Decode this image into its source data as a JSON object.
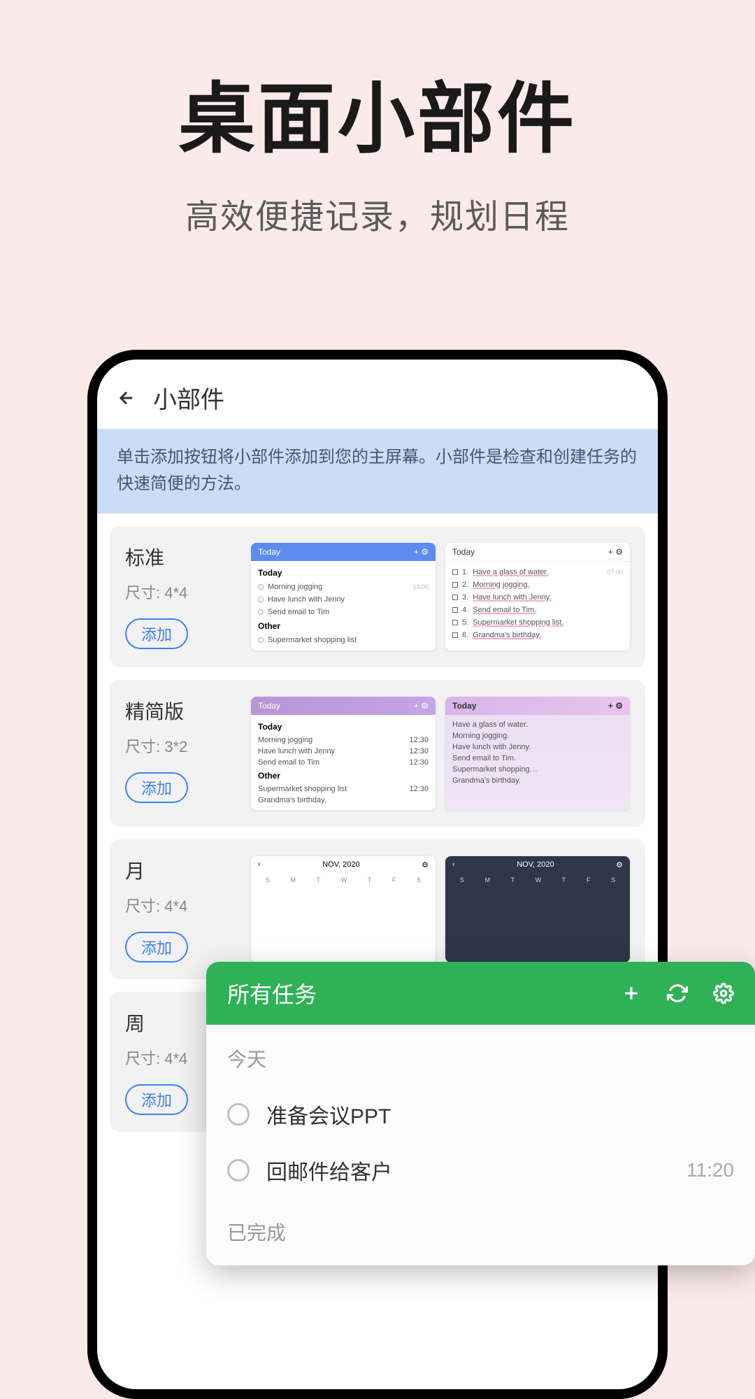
{
  "hero": {
    "title": "桌面小部件",
    "subtitle": "高效便捷记录，规划日程"
  },
  "app": {
    "header_title": "小部件",
    "banner": "单击添加按钮将小部件添加到您的主屏幕。小部件是检查和创建任务的快速简便的方法。",
    "size_prefix": "尺寸: ",
    "add_label": "添加"
  },
  "widgets": [
    {
      "name": "标准",
      "size": "4*4",
      "preview1": {
        "header": "Today",
        "section1": "Today",
        "items1": [
          {
            "text": "Morning jogging",
            "time": "13:00"
          },
          {
            "text": "Have lunch with Jenny",
            "time": ""
          },
          {
            "text": "Send email to Tim",
            "time": ""
          }
        ],
        "section2": "Other",
        "items2": [
          {
            "text": "Supermarket shopping list",
            "time": ""
          }
        ]
      },
      "preview2": {
        "header": "Today",
        "items": [
          {
            "num": "1.",
            "text": "Have a glass of water.",
            "time": "07:00"
          },
          {
            "num": "2.",
            "text": "Morning jogging.",
            "time": ""
          },
          {
            "num": "3.",
            "text": "Have lunch with Jenny.",
            "time": ""
          },
          {
            "num": "4.",
            "text": "Send email to Tim.",
            "time": ""
          },
          {
            "num": "5.",
            "text": "Supermarket shopping list.",
            "time": ""
          },
          {
            "num": "6.",
            "text": "Grandma's birthday.",
            "time": ""
          }
        ]
      }
    },
    {
      "name": "精简版",
      "size": "3*2",
      "preview1": {
        "header": "Today",
        "section1": "Today",
        "items1": [
          {
            "text": "Morning jogging",
            "time": "12:30"
          },
          {
            "text": "Have lunch with Jenny",
            "time": "12:30"
          },
          {
            "text": "Send email to Tim",
            "time": "12:30"
          }
        ],
        "section2": "Other",
        "items2": [
          {
            "text": "Supermarket shopping list",
            "time": "12:30"
          },
          {
            "text": "Grandma's birthday.",
            "time": ""
          }
        ]
      },
      "preview2": {
        "header": "Today",
        "items": [
          {
            "text": "Have a glass of water."
          },
          {
            "text": "Morning jogging."
          },
          {
            "text": "Have lunch with Jenny."
          },
          {
            "text": "Send email to Tim."
          },
          {
            "text": "Supermarket shopping…"
          },
          {
            "text": "Grandma's birthday."
          }
        ]
      }
    },
    {
      "name": "月",
      "size": "4*4",
      "cal_label": "NOV, 2020",
      "days": [
        "S",
        "M",
        "T",
        "W",
        "T",
        "F",
        "S"
      ]
    },
    {
      "name": "周",
      "size": "4*4"
    }
  ],
  "overlay": {
    "title": "所有任务",
    "section_today": "今天",
    "tasks": [
      {
        "text": "准备会议PPT",
        "time": ""
      },
      {
        "text": "回邮件给客户",
        "time": "11:20"
      }
    ],
    "section_done": "已完成"
  }
}
